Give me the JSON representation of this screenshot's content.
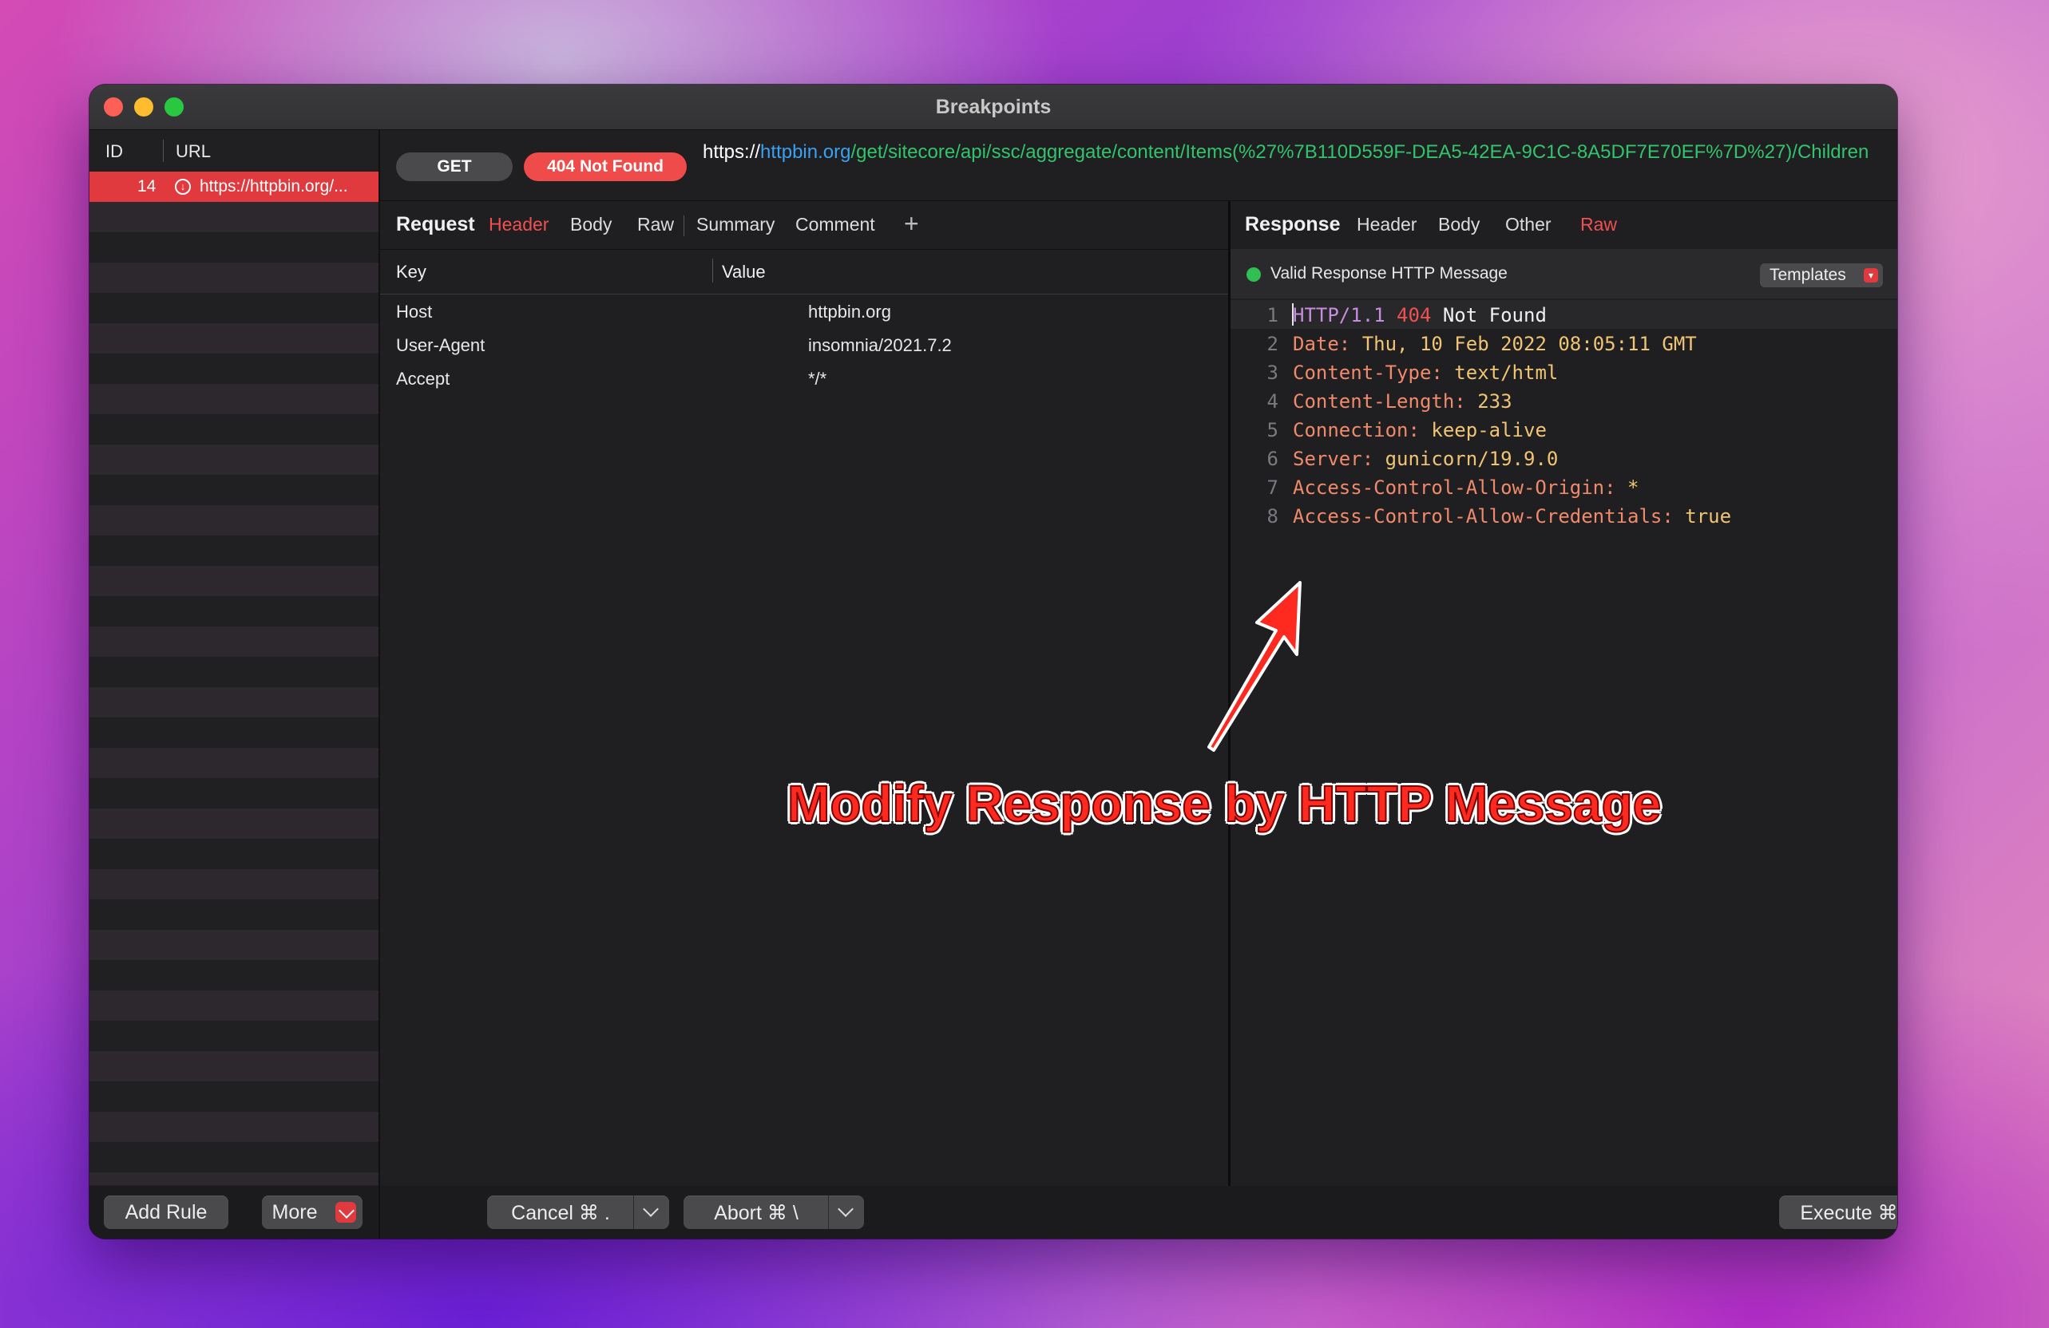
{
  "window": {
    "title": "Breakpoints"
  },
  "sidebar": {
    "headers": {
      "id": "ID",
      "url": "URL"
    },
    "rows": [
      {
        "id": "14",
        "url": "https://httpbin.org/..."
      }
    ],
    "footer": {
      "add_rule": "Add Rule",
      "more": "More"
    }
  },
  "request_line": {
    "method": "GET",
    "status": "404 Not Found",
    "url_scheme": "https://",
    "url_host": "httpbin.org",
    "url_path": "/get/sitecore/api/ssc/aggregate/content/Items(%27%7B110D559F-DEA5-42EA-9C1C-8A5DF7E70EF%7D%27)/Children"
  },
  "request_pane": {
    "title": "Request",
    "tabs": [
      "Header",
      "Body",
      "Raw",
      "Summary",
      "Comment"
    ],
    "active_tab": "Header",
    "add_symbol": "+",
    "columns": {
      "key": "Key",
      "value": "Value"
    },
    "headers": [
      {
        "key": "Host",
        "value": "httpbin.org"
      },
      {
        "key": "User-Agent",
        "value": "insomnia/2021.7.2"
      },
      {
        "key": "Accept",
        "value": "*/*"
      }
    ]
  },
  "response_pane": {
    "title": "Response",
    "tabs": [
      "Header",
      "Body",
      "Other",
      "Raw"
    ],
    "active_tab": "Raw",
    "validity": "Valid Response HTTP Message",
    "templates_button": "Templates",
    "lines": [
      {
        "n": "1",
        "a": "HTTP/1.1",
        "b": "404",
        "c": "Not Found"
      },
      {
        "n": "2",
        "key": "Date:",
        "val": "Thu, 10 Feb 2022 08:05:11 GMT"
      },
      {
        "n": "3",
        "key": "Content-Type:",
        "val": "text/html"
      },
      {
        "n": "4",
        "key": "Content-Length:",
        "val": "233"
      },
      {
        "n": "5",
        "key": "Connection:",
        "val": "keep-alive"
      },
      {
        "n": "6",
        "key": "Server:",
        "val": "gunicorn/19.9.0"
      },
      {
        "n": "7",
        "key": "Access-Control-Allow-Origin:",
        "val": "*"
      },
      {
        "n": "8",
        "key": "Access-Control-Allow-Credentials:",
        "val": "true"
      }
    ]
  },
  "footer": {
    "cancel": "Cancel ⌘ .",
    "abort": "Abort ⌘ \\",
    "execute": "Execute ⌘↩"
  },
  "annotation": "Modify Response by HTTP Message",
  "colors": {
    "accent_red": "#e0393e",
    "status_red": "#ef4b4b",
    "valid_green": "#2fbf52",
    "url_host_blue": "#3aa0f0",
    "url_path_green": "#33c36b"
  }
}
